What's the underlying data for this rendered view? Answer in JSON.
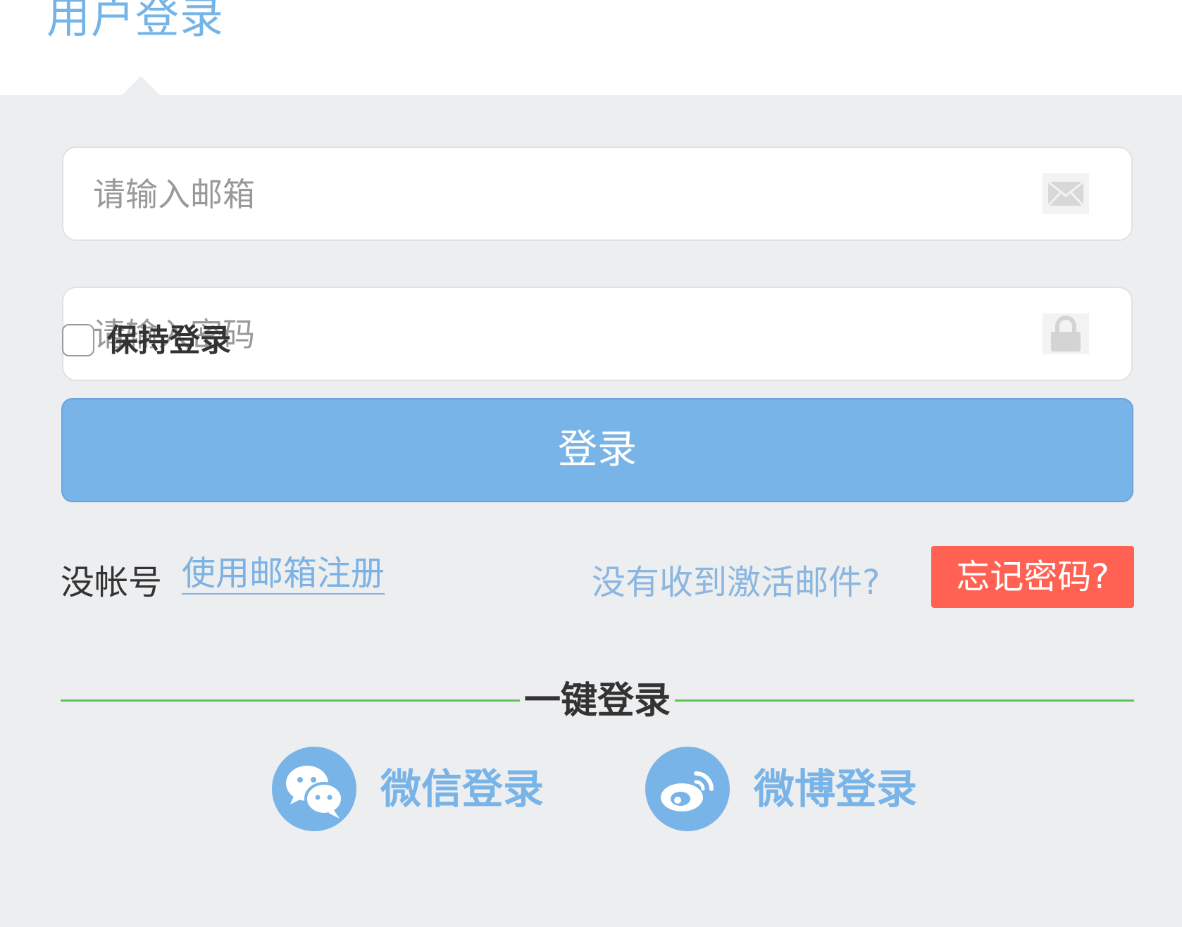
{
  "header": {
    "title": "用户登录"
  },
  "form": {
    "email": {
      "placeholder": "请输入邮箱",
      "value": "",
      "icon": "mail-icon"
    },
    "password": {
      "placeholder": "请输入密码",
      "value": "",
      "icon": "lock-icon"
    },
    "remember": {
      "label": "保持登录",
      "checked": false
    },
    "submit_label": "登录"
  },
  "links": {
    "no_account": "没帐号",
    "register": "使用邮箱注册",
    "activation": "没有收到激活邮件?",
    "forgot": "忘记密码?"
  },
  "quick_login": {
    "title": "一键登录",
    "wechat": {
      "label": "微信登录",
      "icon": "wechat-icon"
    },
    "weibo": {
      "label": "微博登录",
      "icon": "weibo-icon"
    }
  },
  "colors": {
    "accent": "#78b4e8",
    "danger": "#ff6152",
    "divider": "#5fc35a",
    "panel_bg": "#edeef0"
  }
}
